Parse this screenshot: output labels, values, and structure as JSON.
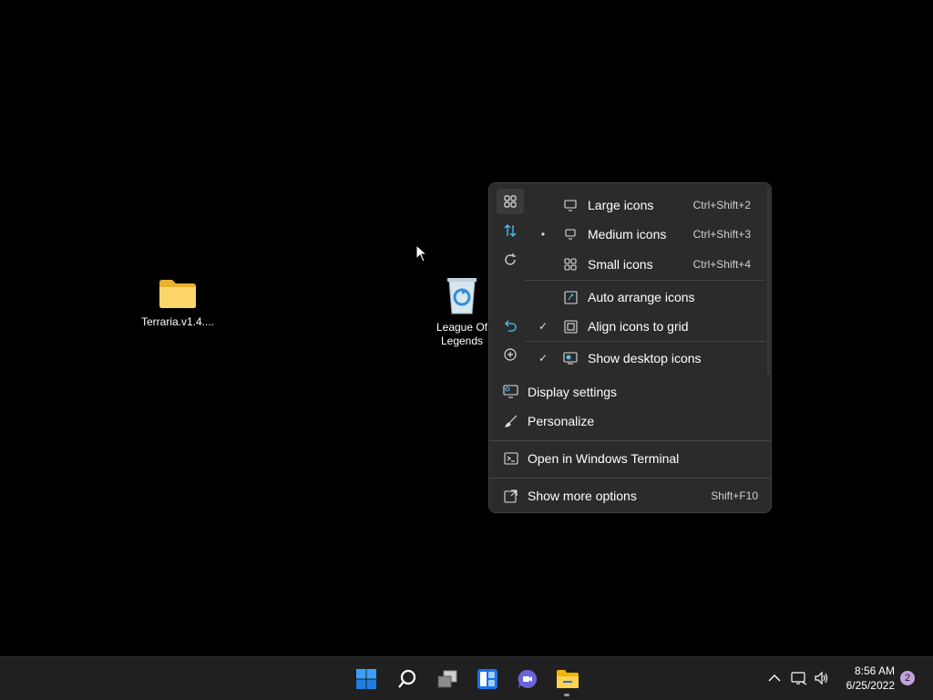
{
  "desktop": {
    "icons": [
      {
        "label": "Terraria.v1.4....",
        "icon": "folder-icon"
      },
      {
        "label_line1": "League Of",
        "label_line2": "Legends",
        "icon": "recycle-bin-icon"
      }
    ]
  },
  "context_menu": {
    "quick_actions": [
      {
        "icon": "view-icon",
        "active": true
      },
      {
        "icon": "sort-icon"
      },
      {
        "icon": "refresh-icon"
      },
      {
        "icon": "undo-icon"
      },
      {
        "icon": "new-icon"
      }
    ],
    "view_submenu": [
      {
        "label": "Large icons",
        "shortcut": "Ctrl+Shift+2",
        "mark": "",
        "icon": "monitor-large-icon"
      },
      {
        "label": "Medium icons",
        "shortcut": "Ctrl+Shift+3",
        "mark": "•",
        "icon": "monitor-medium-icon"
      },
      {
        "label": "Small icons",
        "shortcut": "Ctrl+Shift+4",
        "mark": "",
        "icon": "grid-small-icon"
      },
      {
        "label": "Auto arrange icons",
        "shortcut": "",
        "mark": "",
        "icon": "auto-arrange-icon"
      },
      {
        "label": "Align icons to grid",
        "shortcut": "",
        "mark": "✓",
        "icon": "align-grid-icon"
      },
      {
        "label": "Show desktop icons",
        "shortcut": "",
        "mark": "✓",
        "icon": "show-desktop-icon"
      }
    ],
    "items": [
      {
        "label": "Display settings",
        "shortcut": "",
        "icon": "display-settings-icon"
      },
      {
        "label": "Personalize",
        "shortcut": "",
        "icon": "brush-icon"
      },
      {
        "label": "Open in Windows Terminal",
        "shortcut": "",
        "icon": "terminal-icon"
      },
      {
        "label": "Show more options",
        "shortcut": "Shift+F10",
        "icon": "expand-icon"
      }
    ]
  },
  "taskbar": {
    "apps": [
      "start-icon",
      "search-icon",
      "task-view-icon",
      "widgets-icon",
      "chat-icon",
      "file-explorer-icon"
    ],
    "clock": {
      "time": "8:56 AM",
      "date": "6/25/2022"
    },
    "notifications": "2"
  },
  "colors": {
    "accent": "#4cc2ff",
    "menu_bg": "#2b2b2b",
    "taskbar_bg": "#202020",
    "desktop_bg": "#000000"
  }
}
